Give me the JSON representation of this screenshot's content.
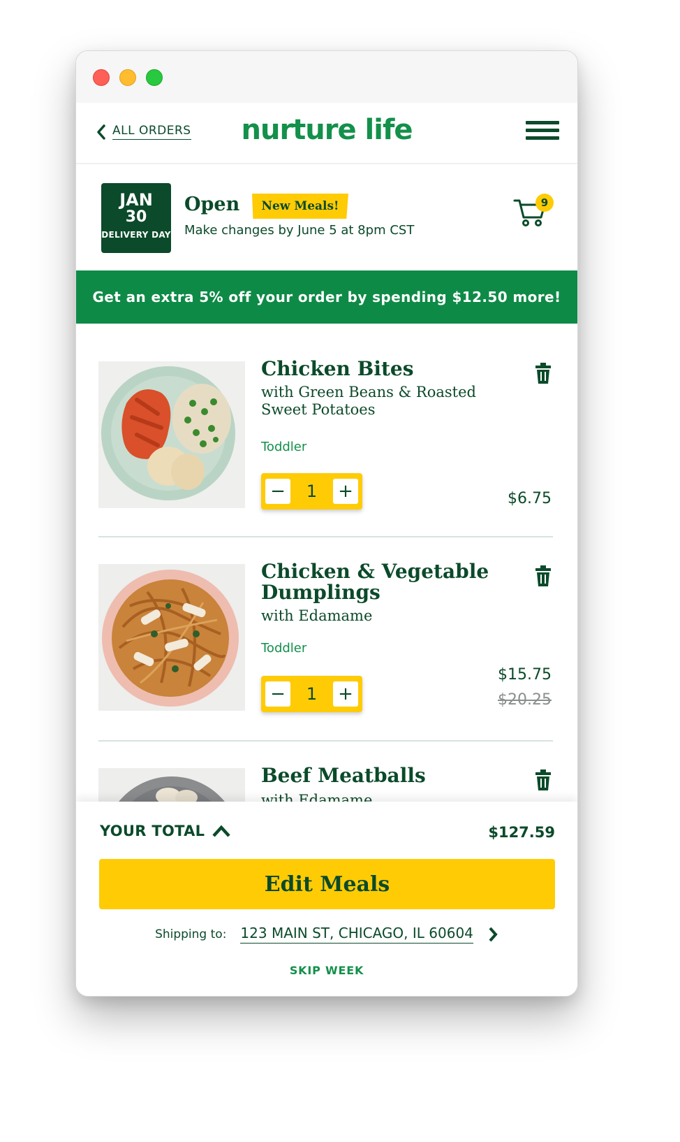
{
  "nav": {
    "back_label": "ALL ORDERS",
    "logo": "nurture life",
    "menu_icon": "hamburger-menu-icon"
  },
  "order": {
    "date_month": "JAN",
    "date_day": "30",
    "date_label": "DELIVERY DAY",
    "status": "Open",
    "badge": "New Meals!",
    "subtitle": "Make changes by June 5 at 8pm CST",
    "cart_count": "9"
  },
  "promo": {
    "text": "Get an extra 5% off your order by spending $12.50 more!"
  },
  "meals": [
    {
      "name": "Chicken Bites",
      "desc": "with Green Beans & Roasted Sweet Potatoes",
      "size": "Toddler",
      "qty": "1",
      "price": "$6.75",
      "minus": "−",
      "plus": "+"
    },
    {
      "name": "Chicken & Vegetable Dumplings",
      "desc": "with Edamame",
      "size": "Toddler",
      "qty": "1",
      "price": "$15.75",
      "orig_price": "$20.25",
      "minus": "−",
      "plus": "+"
    },
    {
      "name": "Beef Meatballs",
      "desc": "with Edamame"
    }
  ],
  "footer": {
    "total_label": "YOUR TOTAL",
    "total_value": "$127.59",
    "edit_button": "Edit Meals",
    "shipping_label": "Shipping to:",
    "shipping_address": "123 MAIN ST, CHICAGO, IL 60604",
    "skip_week": "SKIP WEEK"
  },
  "colors": {
    "brand_green": "#13904a",
    "dark_green": "#0b4a2a",
    "accent_yellow": "#ffcb05",
    "banner_green": "#0e8a47"
  }
}
